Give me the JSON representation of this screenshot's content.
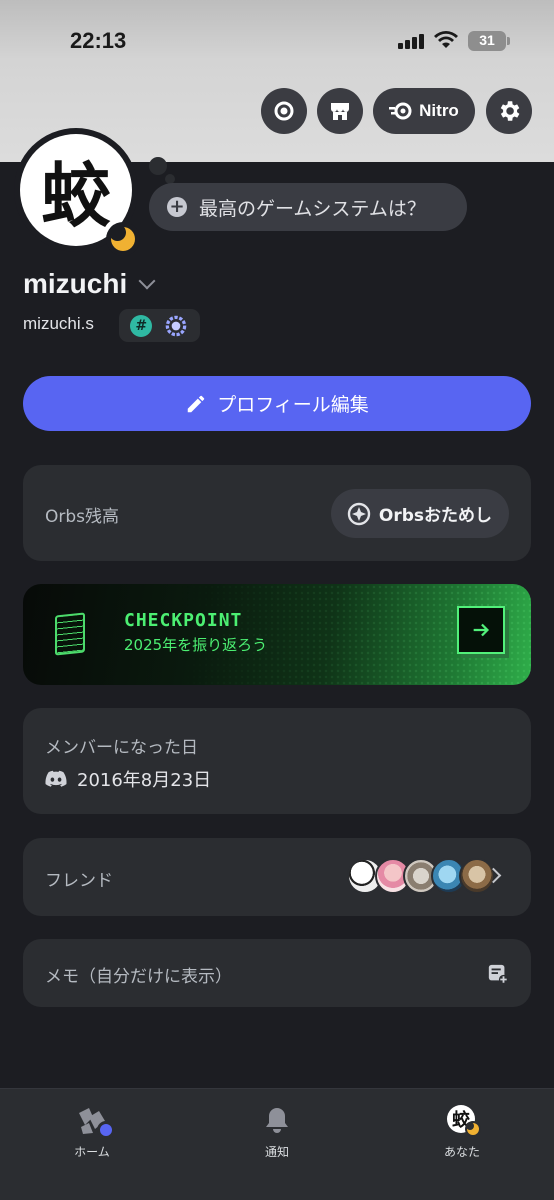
{
  "status_bar": {
    "time": "22:13",
    "battery": "31"
  },
  "header": {
    "nitro_label": "Nitro"
  },
  "profile": {
    "avatar_char": "蛟",
    "status_prompt": "最高のゲームシステムは？",
    "display_name": "mizuchi",
    "username": "mizuchi.s",
    "edit_button": "プロフィール編集"
  },
  "orbs": {
    "label": "Orbs残高",
    "button": "Orbsおためし"
  },
  "checkpoint": {
    "title": "CHECKPOINT",
    "subtitle": "2025年を振り返ろう"
  },
  "member_since": {
    "label": "メンバーになった日",
    "date": "2016年8月23日"
  },
  "friends": {
    "label": "フレンド"
  },
  "memo": {
    "label": "メモ（自分だけに表示）"
  },
  "tabs": [
    {
      "label": "ホーム"
    },
    {
      "label": "通知"
    },
    {
      "label": "あなた"
    }
  ],
  "colors": {
    "accent": "#5865f2",
    "idle": "#f0b132",
    "checkpoint_green": "#4cef72"
  }
}
